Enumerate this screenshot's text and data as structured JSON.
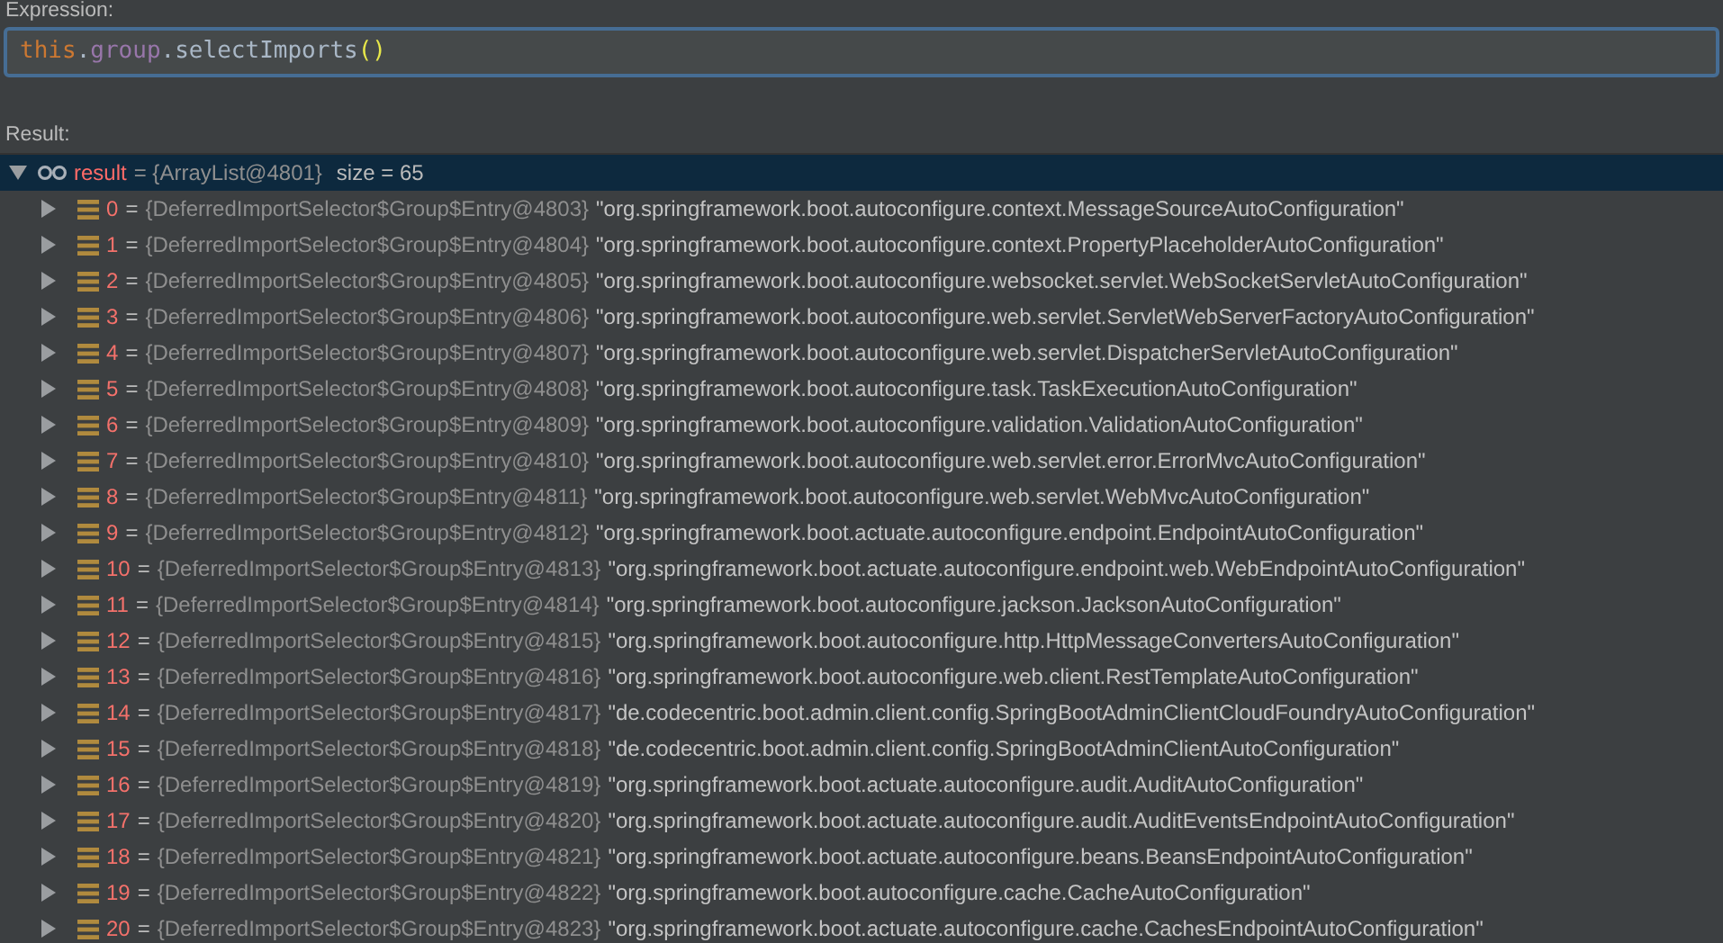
{
  "expression": {
    "label": "Expression:",
    "tokens": [
      {
        "kind": "keyword",
        "text": "this"
      },
      {
        "kind": "plain",
        "text": "."
      },
      {
        "kind": "field",
        "text": "group"
      },
      {
        "kind": "plain",
        "text": ".selectImports"
      },
      {
        "kind": "brace",
        "text": "()"
      }
    ]
  },
  "result": {
    "label": "Result:",
    "root": {
      "name": "result",
      "type": "= {ArrayList@4801}",
      "size": "size = 65",
      "expanded": true,
      "selected": true,
      "children": [
        {
          "index": "0",
          "eq": "=",
          "type": "{DeferredImportSelector$Group$Entry@4803}",
          "value": "\"org.springframework.boot.autoconfigure.context.MessageSourceAutoConfiguration\"",
          "expanded": false
        },
        {
          "index": "1",
          "eq": "=",
          "type": "{DeferredImportSelector$Group$Entry@4804}",
          "value": "\"org.springframework.boot.autoconfigure.context.PropertyPlaceholderAutoConfiguration\"",
          "expanded": false
        },
        {
          "index": "2",
          "eq": "=",
          "type": "{DeferredImportSelector$Group$Entry@4805}",
          "value": "\"org.springframework.boot.autoconfigure.websocket.servlet.WebSocketServletAutoConfiguration\"",
          "expanded": false
        },
        {
          "index": "3",
          "eq": "=",
          "type": "{DeferredImportSelector$Group$Entry@4806}",
          "value": "\"org.springframework.boot.autoconfigure.web.servlet.ServletWebServerFactoryAutoConfiguration\"",
          "expanded": false
        },
        {
          "index": "4",
          "eq": "=",
          "type": "{DeferredImportSelector$Group$Entry@4807}",
          "value": "\"org.springframework.boot.autoconfigure.web.servlet.DispatcherServletAutoConfiguration\"",
          "expanded": false
        },
        {
          "index": "5",
          "eq": "=",
          "type": "{DeferredImportSelector$Group$Entry@4808}",
          "value": "\"org.springframework.boot.autoconfigure.task.TaskExecutionAutoConfiguration\"",
          "expanded": false
        },
        {
          "index": "6",
          "eq": "=",
          "type": "{DeferredImportSelector$Group$Entry@4809}",
          "value": "\"org.springframework.boot.autoconfigure.validation.ValidationAutoConfiguration\"",
          "expanded": false
        },
        {
          "index": "7",
          "eq": "=",
          "type": "{DeferredImportSelector$Group$Entry@4810}",
          "value": "\"org.springframework.boot.autoconfigure.web.servlet.error.ErrorMvcAutoConfiguration\"",
          "expanded": false
        },
        {
          "index": "8",
          "eq": "=",
          "type": "{DeferredImportSelector$Group$Entry@4811}",
          "value": "\"org.springframework.boot.autoconfigure.web.servlet.WebMvcAutoConfiguration\"",
          "expanded": false
        },
        {
          "index": "9",
          "eq": "=",
          "type": "{DeferredImportSelector$Group$Entry@4812}",
          "value": "\"org.springframework.boot.actuate.autoconfigure.endpoint.EndpointAutoConfiguration\"",
          "expanded": false
        },
        {
          "index": "10",
          "eq": "=",
          "type": "{DeferredImportSelector$Group$Entry@4813}",
          "value": "\"org.springframework.boot.actuate.autoconfigure.endpoint.web.WebEndpointAutoConfiguration\"",
          "expanded": false
        },
        {
          "index": "11",
          "eq": "=",
          "type": "{DeferredImportSelector$Group$Entry@4814}",
          "value": "\"org.springframework.boot.autoconfigure.jackson.JacksonAutoConfiguration\"",
          "expanded": false
        },
        {
          "index": "12",
          "eq": "=",
          "type": "{DeferredImportSelector$Group$Entry@4815}",
          "value": "\"org.springframework.boot.autoconfigure.http.HttpMessageConvertersAutoConfiguration\"",
          "expanded": false
        },
        {
          "index": "13",
          "eq": "=",
          "type": "{DeferredImportSelector$Group$Entry@4816}",
          "value": "\"org.springframework.boot.autoconfigure.web.client.RestTemplateAutoConfiguration\"",
          "expanded": false
        },
        {
          "index": "14",
          "eq": "=",
          "type": "{DeferredImportSelector$Group$Entry@4817}",
          "value": "\"de.codecentric.boot.admin.client.config.SpringBootAdminClientCloudFoundryAutoConfiguration\"",
          "expanded": false
        },
        {
          "index": "15",
          "eq": "=",
          "type": "{DeferredImportSelector$Group$Entry@4818}",
          "value": "\"de.codecentric.boot.admin.client.config.SpringBootAdminClientAutoConfiguration\"",
          "expanded": false
        },
        {
          "index": "16",
          "eq": "=",
          "type": "{DeferredImportSelector$Group$Entry@4819}",
          "value": "\"org.springframework.boot.actuate.autoconfigure.audit.AuditAutoConfiguration\"",
          "expanded": false
        },
        {
          "index": "17",
          "eq": "=",
          "type": "{DeferredImportSelector$Group$Entry@4820}",
          "value": "\"org.springframework.boot.actuate.autoconfigure.audit.AuditEventsEndpointAutoConfiguration\"",
          "expanded": false
        },
        {
          "index": "18",
          "eq": "=",
          "type": "{DeferredImportSelector$Group$Entry@4821}",
          "value": "\"org.springframework.boot.actuate.autoconfigure.beans.BeansEndpointAutoConfiguration\"",
          "expanded": false
        },
        {
          "index": "19",
          "eq": "=",
          "type": "{DeferredImportSelector$Group$Entry@4822}",
          "value": "\"org.springframework.boot.autoconfigure.cache.CacheAutoConfiguration\"",
          "expanded": false
        },
        {
          "index": "20",
          "eq": "=",
          "type": "{DeferredImportSelector$Group$Entry@4823}",
          "value": "\"org.springframework.boot.actuate.autoconfigure.cache.CachesEndpointAutoConfiguration\"",
          "expanded": false
        }
      ]
    }
  }
}
